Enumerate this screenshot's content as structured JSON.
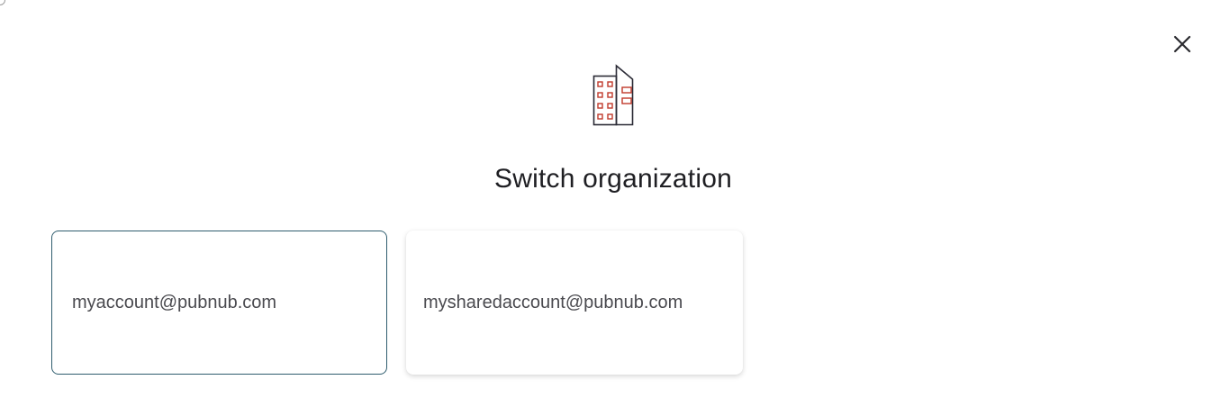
{
  "dialog": {
    "title": "Switch organization",
    "close_icon": "close-icon",
    "header_icon": "building-icon"
  },
  "organizations": [
    {
      "label": "myaccount@pubnub.com",
      "selected": true
    },
    {
      "label": "mysharedaccount@pubnub.com",
      "selected": false
    }
  ],
  "colors": {
    "selected_border": "#2f5d6e",
    "icon_stroke": "#2b2b36",
    "icon_accent": "#c0392b",
    "title_text": "#1f1f23",
    "card_text": "#4a4a4f"
  }
}
